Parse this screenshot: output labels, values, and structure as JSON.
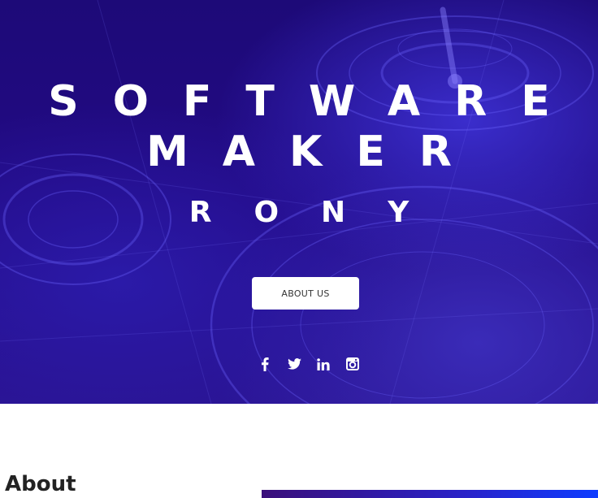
{
  "hero": {
    "title": "SOFTWARE MAKER",
    "subtitle": "RONY",
    "cta_label": "ABOUT US",
    "socials": [
      {
        "name": "facebook-icon",
        "glyph": "f"
      },
      {
        "name": "twitter-icon",
        "glyph": "twitter"
      },
      {
        "name": "linkedin-icon",
        "glyph": "in"
      },
      {
        "name": "instagram-icon",
        "glyph": "instagram"
      }
    ],
    "colors": {
      "background": "#230a86",
      "text": "#ffffff",
      "button_bg": "#ffffff",
      "button_text": "#333333"
    }
  },
  "about": {
    "heading": "About"
  }
}
